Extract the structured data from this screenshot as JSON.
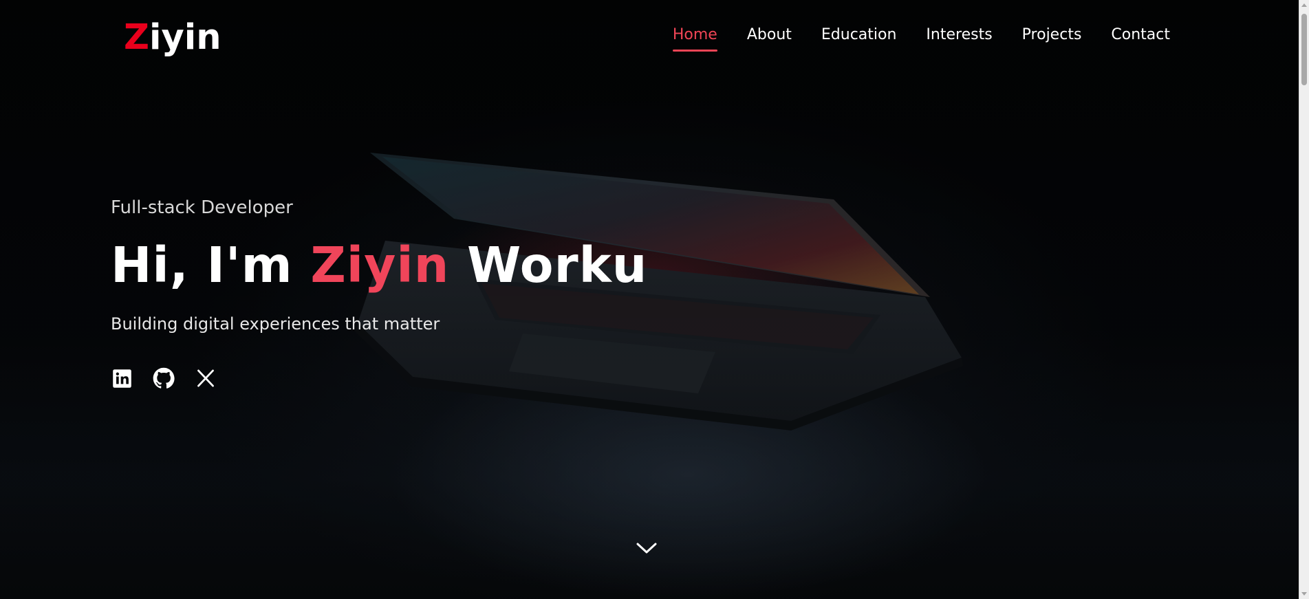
{
  "brand": {
    "logo_first_letter": "Z",
    "logo_rest": "iyin"
  },
  "nav": {
    "items": [
      {
        "label": "Home",
        "active": true
      },
      {
        "label": "About",
        "active": false
      },
      {
        "label": "Education",
        "active": false
      },
      {
        "label": "Interests",
        "active": false
      },
      {
        "label": "Projects",
        "active": false
      },
      {
        "label": "Contact",
        "active": false
      }
    ]
  },
  "hero": {
    "role": "Full-stack Developer",
    "greeting": "Hi, I'm",
    "first_name": "Ziyin",
    "last_name": "Worku",
    "tagline": "Building digital experiences that matter",
    "socials": [
      {
        "icon": "linkedin-icon"
      },
      {
        "icon": "github-icon"
      },
      {
        "icon": "x-icon"
      }
    ],
    "scroll_icon": "chevron-down-icon"
  },
  "colors": {
    "accent": "#f0455a",
    "logo_accent": "#e9001c",
    "background": "#050608",
    "text": "#ffffff"
  }
}
